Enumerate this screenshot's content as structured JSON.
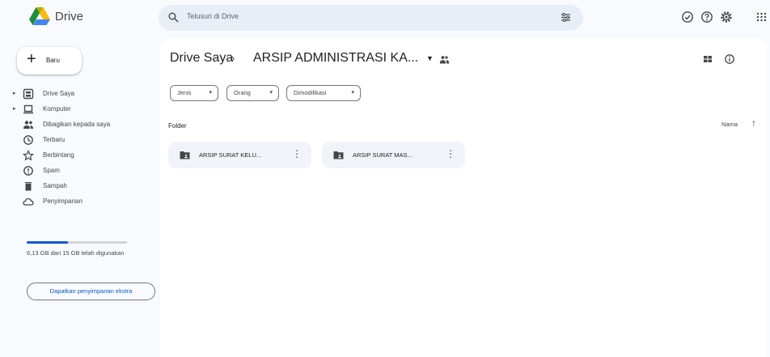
{
  "app": {
    "brand": "Drive",
    "colors": {
      "blue": "#0b57d0",
      "green": "#1e8e3e",
      "yellow": "#fbbc04",
      "red": "#d93025"
    }
  },
  "search": {
    "placeholder": "Telusuri di Drive"
  },
  "header_icons": [
    "status-icon",
    "help-icon",
    "settings-icon",
    "apps-grid-icon"
  ],
  "sidebar": {
    "new_label": "Baru",
    "items": [
      {
        "label": "Drive Saya",
        "icon": "my-drive-icon"
      },
      {
        "label": "Komputer",
        "icon": "computer-icon"
      },
      {
        "label": "Dibagikan kepada saya",
        "icon": "shared-icon"
      },
      {
        "label": "Terbaru",
        "icon": "recent-icon"
      },
      {
        "label": "Berbintang",
        "icon": "star-icon"
      },
      {
        "label": "Spam",
        "icon": "spam-icon"
      },
      {
        "label": "Sampah",
        "icon": "trash-icon"
      },
      {
        "label": "Penyimpanan",
        "icon": "cloud-icon"
      }
    ],
    "storage_used_fraction": 0.41,
    "storage_text": "6,13 GB dari 15 GB telah digunakan",
    "get_storage": "Dapatkan penyimpanan ekstra"
  },
  "main": {
    "breadcrumb_root": "Drive Saya",
    "breadcrumb_sep": "›",
    "breadcrumb_current": "ARSIP ADMINISTRASI KA...",
    "filters": [
      "Jenis",
      "Orang",
      "Dimodifikasi"
    ],
    "section_label": "Folder",
    "sort_label": "Nama",
    "folders": [
      {
        "name": "ARSIP SURAT KELU..."
      },
      {
        "name": "ARSIP SURAT MAS..."
      }
    ]
  }
}
